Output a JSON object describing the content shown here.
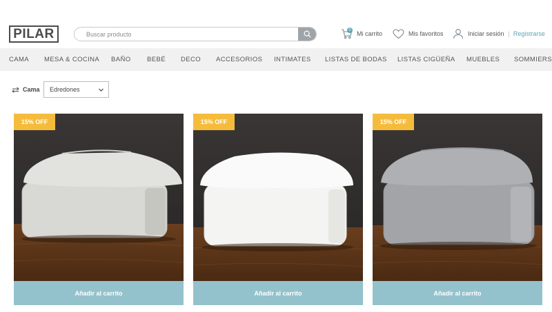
{
  "brand": {
    "logo_text": "PILAR"
  },
  "search": {
    "placeholder": "Buscar producto"
  },
  "header": {
    "cart_label": "Mi carrito",
    "cart_count": "0",
    "favorites_label": "Mis favoritos",
    "login_label": "Iniciar sesión",
    "separator": "|",
    "register_label": "Registrarse"
  },
  "nav": {
    "items": [
      {
        "label": "CAMA"
      },
      {
        "label": "MESA & COCINA"
      },
      {
        "label": "BAÑO"
      },
      {
        "label": "BEBÉ"
      },
      {
        "label": "DECO"
      },
      {
        "label": "ACCESORIOS"
      },
      {
        "label": "INTIMATES"
      },
      {
        "label": "LISTAS DE BODAS"
      },
      {
        "label": "LISTAS CIGÜEÑA"
      },
      {
        "label": "MUEBLES"
      },
      {
        "label": "SOMMIERS"
      }
    ]
  },
  "filter": {
    "category_label": "Cama",
    "selected": "Edredones"
  },
  "products": [
    {
      "badge": "15% OFF",
      "button": "Añadir al carrito",
      "color": "#dcdcd8"
    },
    {
      "badge": "15% OFF",
      "button": "Añadir al carrito",
      "color": "#f4f4f2"
    },
    {
      "badge": "15% OFF",
      "button": "Añadir al carrito",
      "color": "#a7a9ad"
    }
  ],
  "colors": {
    "accent": "#5aa6b8",
    "button": "#94c2cc",
    "badge": "#f5bc3c",
    "nav_bg": "#f1f1f1"
  }
}
